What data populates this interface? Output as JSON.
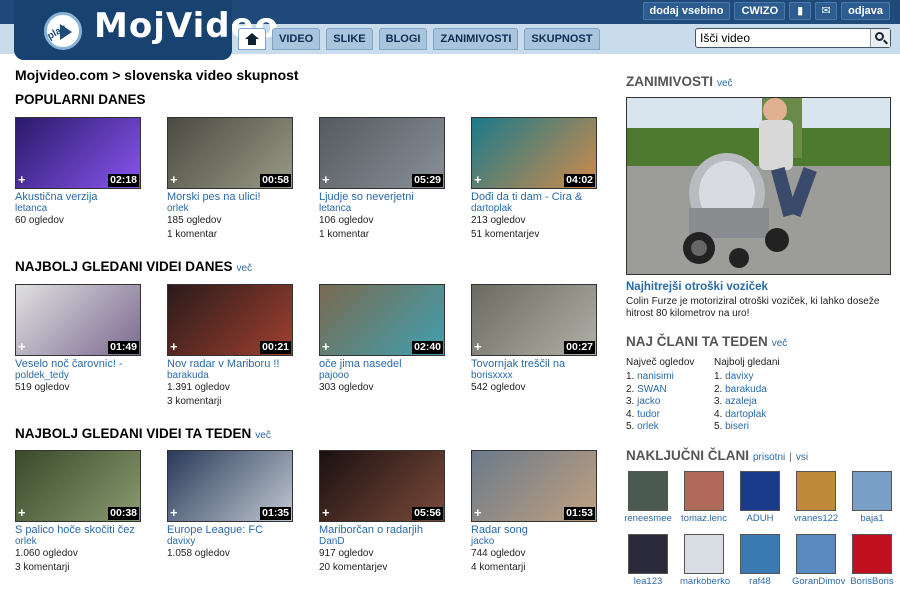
{
  "header": {
    "logo_text": "MojVideo",
    "logo_play": "play",
    "top_links": [
      "dodaj vsebino",
      "CWIZO",
      "odjava"
    ],
    "tabs": [
      "VIDEO",
      "SLIKE",
      "BLOGI",
      "ZANIMIVOSTI",
      "SKUPNOST"
    ],
    "search_value": "Išči video"
  },
  "main": {
    "breadcrumb": "Mojvideo.com > slovenska video skupnost",
    "sections": [
      {
        "title": "POPULARNI DANES",
        "more": "",
        "videos": [
          {
            "title": "Akustična verzija",
            "user": "letanca",
            "views": "60 ogledov",
            "comments": "",
            "duration": "02:18",
            "colors": [
              "#2a1a6a",
              "#8855ee"
            ]
          },
          {
            "title": "Morski pes na ulici!",
            "user": "orlek",
            "views": "185 ogledov",
            "comments": "1 komentar",
            "duration": "00:58",
            "colors": [
              "#4a4a40",
              "#9a9a88"
            ]
          },
          {
            "title": "Ljudje so neverjetni",
            "user": "letanca",
            "views": "106 ogledov",
            "comments": "1 komentar",
            "duration": "05:29",
            "colors": [
              "#555a60",
              "#8a9098"
            ]
          },
          {
            "title": "Dođi da ti dam - Cira &",
            "user": "dartoplak",
            "views": "213 ogledov",
            "comments": "51 komentarjev",
            "duration": "04:02",
            "colors": [
              "#1a7a8a",
              "#d08a4a"
            ]
          }
        ]
      },
      {
        "title": "NAJBOLJ GLEDANI VIDEI DANES",
        "more": "več",
        "videos": [
          {
            "title": "Veselo noč čarovnic! -",
            "user": "poldek_tedy",
            "views": "519 ogledov",
            "comments": "",
            "duration": "01:49",
            "colors": [
              "#e0e0e0",
              "#7a6a90"
            ]
          },
          {
            "title": "Nov radar v Mariboru !!",
            "user": "barakuda",
            "views": "1.391 ogledov",
            "comments": "3 komentarji",
            "duration": "00:21",
            "colors": [
              "#2a1a1a",
              "#a04030"
            ]
          },
          {
            "title": "oče jima nasedel",
            "user": "pajooo",
            "views": "303 ogledov",
            "comments": "",
            "duration": "02:40",
            "colors": [
              "#7a6a50",
              "#40a0b0"
            ]
          },
          {
            "title": "Tovornjak treščil na",
            "user": "borisxxxx",
            "views": "542 ogledov",
            "comments": "",
            "duration": "00:27",
            "colors": [
              "#6a6a60",
              "#b0b0a8"
            ]
          }
        ]
      },
      {
        "title": "NAJBOLJ GLEDANI VIDEI TA TEDEN",
        "more": "več",
        "videos": [
          {
            "title": "S palico hoče skočiti čez",
            "user": "orlek",
            "views": "1.060 ogledov",
            "comments": "3 komentarji",
            "duration": "00:38",
            "colors": [
              "#3a4a2a",
              "#8a9a70"
            ]
          },
          {
            "title": "Europe League: FC",
            "user": "davixy",
            "views": "1.058 ogledov",
            "comments": "",
            "duration": "01:35",
            "colors": [
              "#2a3a5a",
              "#c0c8d0"
            ]
          },
          {
            "title": "Mariborčan o radarjih",
            "user": "DanD",
            "views": "917 ogledov",
            "comments": "20 komentarjev",
            "duration": "05:56",
            "colors": [
              "#1a1010",
              "#7a4a3a"
            ]
          },
          {
            "title": "Radar song",
            "user": "jacko",
            "views": "744 ogledov",
            "comments": "4 komentarji",
            "duration": "01:53",
            "colors": [
              "#6a7a8a",
              "#c0a080"
            ]
          }
        ]
      }
    ]
  },
  "right": {
    "zanimivosti": {
      "title": "ZANIMIVOSTI",
      "more": "več",
      "feature_title": "Najhitrejši otroški voziček",
      "feature_desc": "Colin Furze je motoriziral otroški voziček, ki lahko doseže hitrost 80 kilometrov na uro!"
    },
    "naj_clani": {
      "title": "NAJ ČLANI TA TEDEN",
      "more": "več",
      "col1_header": "Največ ogledov",
      "col1": [
        "nanisimi",
        "SWAN",
        "jacko",
        "tudor",
        "orlek"
      ],
      "col2_header": "Najbolj gledani",
      "col2": [
        "davixy",
        "barakuda",
        "azaleja",
        "dartoplak",
        "biseri"
      ]
    },
    "nakljucni": {
      "title": "NAKLJUČNI ČLANI",
      "link1": "prisotni",
      "sep": "|",
      "link2": "vsi",
      "members": [
        {
          "name": "reneesmee",
          "color": "#4a5a50"
        },
        {
          "name": "tomaz.lenc",
          "color": "#b06a5a"
        },
        {
          "name": "ADUH",
          "color": "#1a3a8a"
        },
        {
          "name": "vranes122",
          "color": "#c08a3a"
        },
        {
          "name": "baja1",
          "color": "#7aa0c8"
        },
        {
          "name": "lea123",
          "color": "#2a2a3a"
        },
        {
          "name": "markoberko",
          "color": "#d8dde4"
        },
        {
          "name": "raf48",
          "color": "#3a7ab0"
        },
        {
          "name": "GoranDimov",
          "color": "#5a8ac0"
        },
        {
          "name": "BorisBoris",
          "color": "#c01020"
        }
      ]
    }
  }
}
